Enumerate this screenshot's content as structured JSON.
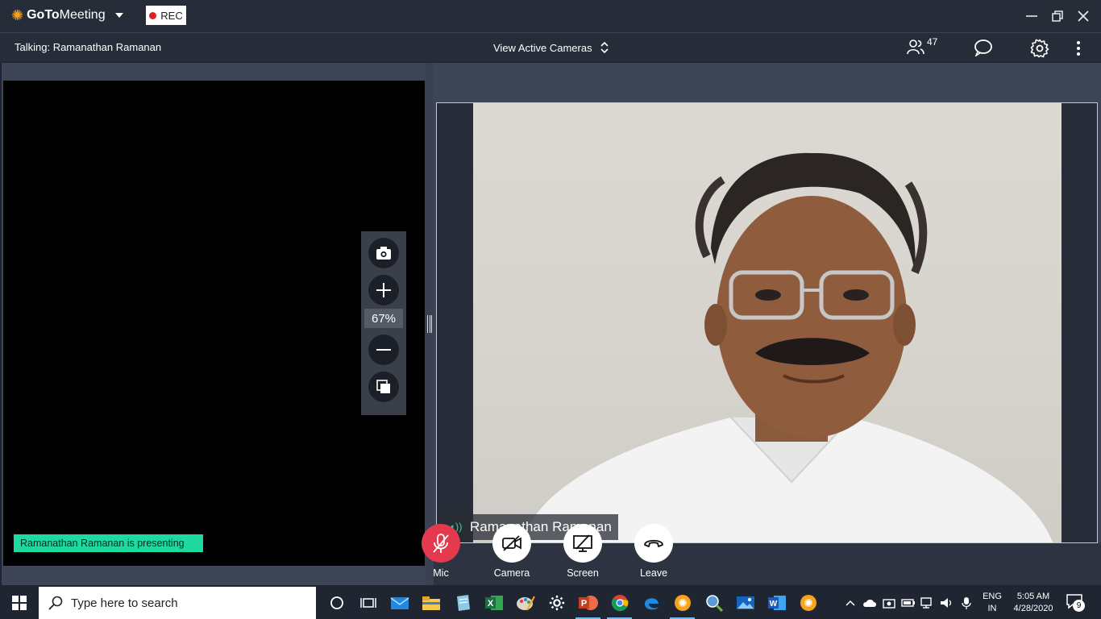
{
  "app": {
    "name_bold": "GoTo",
    "name_rest": "Meeting",
    "rec_label": "REC"
  },
  "toolbar": {
    "talking": "Talking: Ramanathan Ramanan",
    "view_cameras": "View Active Cameras",
    "attendee_count": "47"
  },
  "shared_screen": {
    "zoom_percent": "67%",
    "presenting_banner": "Ramanathan Ramanan is presenting"
  },
  "video": {
    "participant_name": "Ramanathan Ramanan"
  },
  "controls": {
    "mic": "Mic",
    "camera": "Camera",
    "screen": "Screen",
    "leave": "Leave"
  },
  "taskbar": {
    "search_placeholder": "Type here to search",
    "lang_top": "ENG",
    "lang_bottom": "IN",
    "time": "5:05 AM",
    "date": "4/28/2020",
    "notification_count": "9"
  },
  "colors": {
    "accent_green": "#1ed9a0",
    "mic_red": "#e5394f",
    "brand_orange": "#f9a21b"
  }
}
